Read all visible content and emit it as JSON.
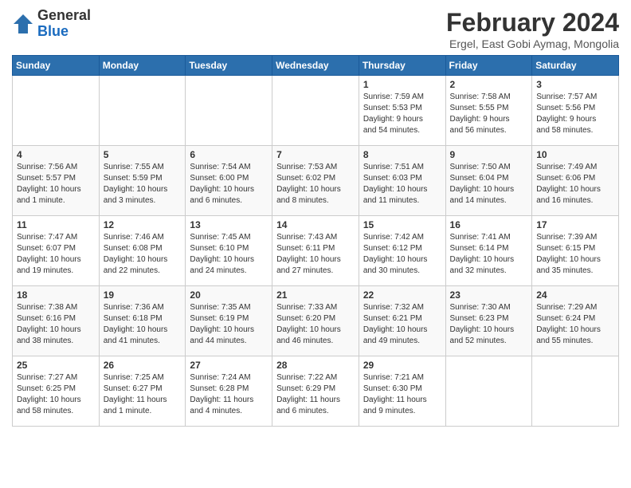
{
  "header": {
    "logo": {
      "general": "General",
      "blue": "Blue"
    },
    "title": "February 2024",
    "subtitle": "Ergel, East Gobi Aymag, Mongolia"
  },
  "weekdays": [
    "Sunday",
    "Monday",
    "Tuesday",
    "Wednesday",
    "Thursday",
    "Friday",
    "Saturday"
  ],
  "weeks": [
    [
      {
        "day": "",
        "info": ""
      },
      {
        "day": "",
        "info": ""
      },
      {
        "day": "",
        "info": ""
      },
      {
        "day": "",
        "info": ""
      },
      {
        "day": "1",
        "info": "Sunrise: 7:59 AM\nSunset: 5:53 PM\nDaylight: 9 hours\nand 54 minutes."
      },
      {
        "day": "2",
        "info": "Sunrise: 7:58 AM\nSunset: 5:55 PM\nDaylight: 9 hours\nand 56 minutes."
      },
      {
        "day": "3",
        "info": "Sunrise: 7:57 AM\nSunset: 5:56 PM\nDaylight: 9 hours\nand 58 minutes."
      }
    ],
    [
      {
        "day": "4",
        "info": "Sunrise: 7:56 AM\nSunset: 5:57 PM\nDaylight: 10 hours\nand 1 minute."
      },
      {
        "day": "5",
        "info": "Sunrise: 7:55 AM\nSunset: 5:59 PM\nDaylight: 10 hours\nand 3 minutes."
      },
      {
        "day": "6",
        "info": "Sunrise: 7:54 AM\nSunset: 6:00 PM\nDaylight: 10 hours\nand 6 minutes."
      },
      {
        "day": "7",
        "info": "Sunrise: 7:53 AM\nSunset: 6:02 PM\nDaylight: 10 hours\nand 8 minutes."
      },
      {
        "day": "8",
        "info": "Sunrise: 7:51 AM\nSunset: 6:03 PM\nDaylight: 10 hours\nand 11 minutes."
      },
      {
        "day": "9",
        "info": "Sunrise: 7:50 AM\nSunset: 6:04 PM\nDaylight: 10 hours\nand 14 minutes."
      },
      {
        "day": "10",
        "info": "Sunrise: 7:49 AM\nSunset: 6:06 PM\nDaylight: 10 hours\nand 16 minutes."
      }
    ],
    [
      {
        "day": "11",
        "info": "Sunrise: 7:47 AM\nSunset: 6:07 PM\nDaylight: 10 hours\nand 19 minutes."
      },
      {
        "day": "12",
        "info": "Sunrise: 7:46 AM\nSunset: 6:08 PM\nDaylight: 10 hours\nand 22 minutes."
      },
      {
        "day": "13",
        "info": "Sunrise: 7:45 AM\nSunset: 6:10 PM\nDaylight: 10 hours\nand 24 minutes."
      },
      {
        "day": "14",
        "info": "Sunrise: 7:43 AM\nSunset: 6:11 PM\nDaylight: 10 hours\nand 27 minutes."
      },
      {
        "day": "15",
        "info": "Sunrise: 7:42 AM\nSunset: 6:12 PM\nDaylight: 10 hours\nand 30 minutes."
      },
      {
        "day": "16",
        "info": "Sunrise: 7:41 AM\nSunset: 6:14 PM\nDaylight: 10 hours\nand 32 minutes."
      },
      {
        "day": "17",
        "info": "Sunrise: 7:39 AM\nSunset: 6:15 PM\nDaylight: 10 hours\nand 35 minutes."
      }
    ],
    [
      {
        "day": "18",
        "info": "Sunrise: 7:38 AM\nSunset: 6:16 PM\nDaylight: 10 hours\nand 38 minutes."
      },
      {
        "day": "19",
        "info": "Sunrise: 7:36 AM\nSunset: 6:18 PM\nDaylight: 10 hours\nand 41 minutes."
      },
      {
        "day": "20",
        "info": "Sunrise: 7:35 AM\nSunset: 6:19 PM\nDaylight: 10 hours\nand 44 minutes."
      },
      {
        "day": "21",
        "info": "Sunrise: 7:33 AM\nSunset: 6:20 PM\nDaylight: 10 hours\nand 46 minutes."
      },
      {
        "day": "22",
        "info": "Sunrise: 7:32 AM\nSunset: 6:21 PM\nDaylight: 10 hours\nand 49 minutes."
      },
      {
        "day": "23",
        "info": "Sunrise: 7:30 AM\nSunset: 6:23 PM\nDaylight: 10 hours\nand 52 minutes."
      },
      {
        "day": "24",
        "info": "Sunrise: 7:29 AM\nSunset: 6:24 PM\nDaylight: 10 hours\nand 55 minutes."
      }
    ],
    [
      {
        "day": "25",
        "info": "Sunrise: 7:27 AM\nSunset: 6:25 PM\nDaylight: 10 hours\nand 58 minutes."
      },
      {
        "day": "26",
        "info": "Sunrise: 7:25 AM\nSunset: 6:27 PM\nDaylight: 11 hours\nand 1 minute."
      },
      {
        "day": "27",
        "info": "Sunrise: 7:24 AM\nSunset: 6:28 PM\nDaylight: 11 hours\nand 4 minutes."
      },
      {
        "day": "28",
        "info": "Sunrise: 7:22 AM\nSunset: 6:29 PM\nDaylight: 11 hours\nand 6 minutes."
      },
      {
        "day": "29",
        "info": "Sunrise: 7:21 AM\nSunset: 6:30 PM\nDaylight: 11 hours\nand 9 minutes."
      },
      {
        "day": "",
        "info": ""
      },
      {
        "day": "",
        "info": ""
      }
    ]
  ]
}
